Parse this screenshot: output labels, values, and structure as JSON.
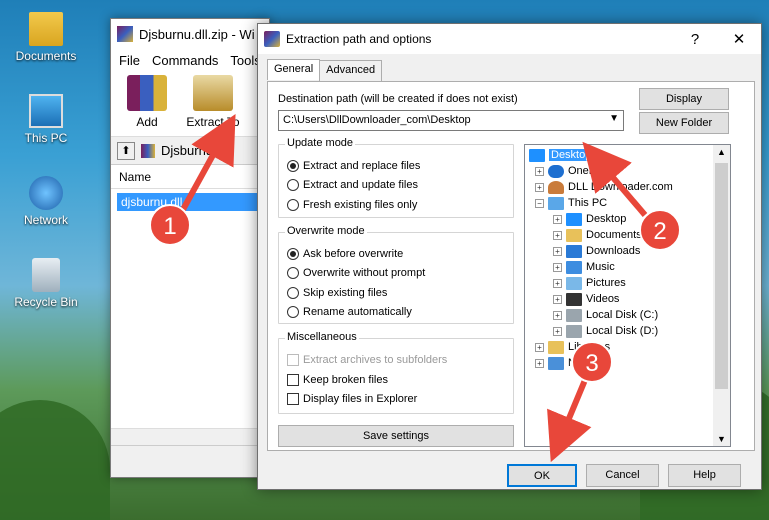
{
  "desktop": {
    "icons": [
      {
        "label": "Documents"
      },
      {
        "label": "This PC"
      },
      {
        "label": "Network"
      },
      {
        "label": "Recycle Bin"
      }
    ]
  },
  "winrar": {
    "title": "Djsburnu.dll.zip - Wi",
    "menu": [
      "File",
      "Commands",
      "Tools"
    ],
    "toolbar": {
      "add": "Add",
      "extract_to": "Extract To"
    },
    "path": "Djsburnu.dll",
    "list_header": "Name",
    "file": "djsburnu.dll"
  },
  "dialog": {
    "title": "Extraction path and options",
    "help_glyph": "?",
    "close_glyph": "✕",
    "tabs": [
      "General",
      "Advanced"
    ],
    "dest_label": "Destination path (will be created if does not exist)",
    "dest_value": "C:\\Users\\DllDownloader_com\\Desktop",
    "display_button": "Display",
    "new_folder_button": "New Folder",
    "update_mode": {
      "title": "Update mode",
      "options": [
        "Extract and replace files",
        "Extract and update files",
        "Fresh existing files only"
      ],
      "selected": 0
    },
    "overwrite_mode": {
      "title": "Overwrite mode",
      "options": [
        "Ask before overwrite",
        "Overwrite without prompt",
        "Skip existing files",
        "Rename automatically"
      ],
      "selected": 0
    },
    "misc": {
      "title": "Miscellaneous",
      "options": [
        "Extract archives to subfolders",
        "Keep broken files",
        "Display files in Explorer"
      ]
    },
    "save_settings": "Save settings",
    "tree": [
      {
        "label": "Desktop",
        "icon": "desktop-icon"
      },
      {
        "label": "OneDrive",
        "icon": "cloud-icon"
      },
      {
        "label": "DLL Downloader.com",
        "icon": "user-icon"
      },
      {
        "label": "This PC",
        "icon": "computer-icon"
      },
      {
        "label": "Desktop",
        "icon": "desktop-icon"
      },
      {
        "label": "Documents",
        "icon": "folder-icon"
      },
      {
        "label": "Downloads",
        "icon": "download-icon"
      },
      {
        "label": "Music",
        "icon": "music-icon"
      },
      {
        "label": "Pictures",
        "icon": "pictures-icon"
      },
      {
        "label": "Videos",
        "icon": "videos-icon"
      },
      {
        "label": "Local Disk (C:)",
        "icon": "drive-icon"
      },
      {
        "label": "Local Disk (D:)",
        "icon": "drive-icon"
      },
      {
        "label": "Libraries",
        "icon": "folder-icon"
      },
      {
        "label": "Network",
        "icon": "network-icon"
      }
    ],
    "ok": "OK",
    "cancel": "Cancel",
    "help": "Help"
  },
  "annotations": [
    "1",
    "2",
    "3"
  ],
  "colors": {
    "selection": "#3399ff",
    "annotation": "#e8473a",
    "default_button_border": "#0078d7"
  }
}
